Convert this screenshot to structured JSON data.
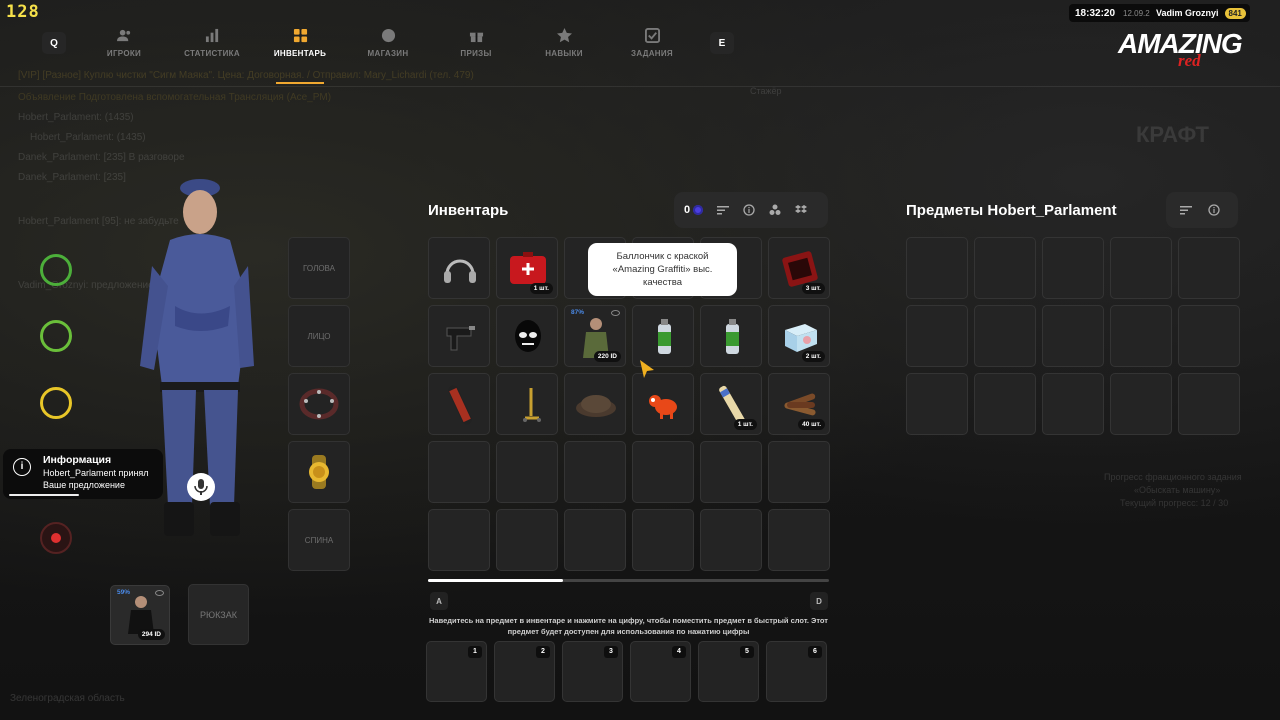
{
  "hud": {
    "fps": "128",
    "time": "18:32:20",
    "date": "12.09.2026",
    "username": "Vadim Groznyi",
    "user_id": "841"
  },
  "nav": {
    "key_left": "Q",
    "key_right": "E",
    "tabs": [
      {
        "label": "ИГРОКИ",
        "icon": "players-icon"
      },
      {
        "label": "СТАТИСТИКА",
        "icon": "stats-icon"
      },
      {
        "label": "ИНВЕНТАРЬ",
        "icon": "inventory-icon",
        "active": true
      },
      {
        "label": "МАГАЗИН",
        "icon": "shop-icon"
      },
      {
        "label": "ПРИЗЫ",
        "icon": "gift-icon"
      },
      {
        "label": "НАВЫКИ",
        "icon": "star-icon"
      },
      {
        "label": "ЗАДАНИЯ",
        "icon": "tasks-icon"
      }
    ]
  },
  "logo": {
    "main": "AMAZING",
    "sub": "red"
  },
  "background": {
    "lines": [
      "[VIP] [Разное] Куплю чистки \"Сигм Маяка\". Цена: Договорная. / Отправил: Mary_Lichardi (тел. 479)",
      "Объявление Подготовлена вспомогательная Трансляция (Ace_PM)",
      "Hobert_Parlament: (1435)",
      "Hobert_Parlament: (1435)",
      "Danek_Parlament: [235] В разговоре",
      "Danek_Parlament: [235]",
      "Hobert_Parlament [95]: не забудьте",
      "Vadim_Groznyi: предложение отправлено"
    ],
    "craft": "КРАФТ",
    "shop_label": "Стажёр",
    "progress_lines": [
      "Прогресс фракционного задания",
      "«Обыскать машину»",
      "Текущий прогресс: 12 / 30"
    ],
    "location": "Зеленоградская область"
  },
  "inventory": {
    "title": "Инвентарь",
    "currency": "0",
    "tooltip": "Баллончик с краской «Amazing Graffiti» выс. качества",
    "items": [
      {
        "icon": "headphones-icon"
      },
      {
        "icon": "first-aid-kit-icon",
        "count": "1 шт."
      },
      {
        "icon": "empty"
      },
      {
        "icon": "empty"
      },
      {
        "icon": "empty"
      },
      {
        "icon": "toolbox-icon",
        "count": "3 шт."
      },
      {
        "icon": "spray-gun-icon"
      },
      {
        "icon": "skull-mask-icon"
      },
      {
        "icon": "outfit-icon",
        "count": "220 ID",
        "pct": "87%",
        "eye": true
      },
      {
        "icon": "spray-can-icon"
      },
      {
        "icon": "spray-can-icon"
      },
      {
        "icon": "gift-box-icon",
        "count": "2 шт."
      },
      {
        "icon": "skateboard-icon"
      },
      {
        "icon": "scooter-icon"
      },
      {
        "icon": "cap-icon"
      },
      {
        "icon": "toy-dog-icon"
      },
      {
        "icon": "firework-icon",
        "count": "1 шт."
      },
      {
        "icon": "logs-icon",
        "count": "40 шт."
      }
    ],
    "scroll_left": "A",
    "scroll_right": "D",
    "hint": "Наведитесь на предмет в инвентаре и нажмите на цифру, чтобы поместить предмет в быстрый слот. Этот предмет будет доступен для использования по нажатию цифры",
    "quick_slots": [
      "1",
      "2",
      "3",
      "4",
      "5",
      "6"
    ]
  },
  "other": {
    "title": "Предметы Hobert_Parlament"
  },
  "equipment": {
    "head": "ГОЛОВА",
    "face": "ЛИЦО",
    "back": "СПИНА",
    "backpack": "РЮКЗАК",
    "outfit_id": "294 ID",
    "outfit_pct": "59%"
  },
  "notification": {
    "title": "Информация",
    "text": "Hobert_Parlament принял Ваше предложение"
  }
}
